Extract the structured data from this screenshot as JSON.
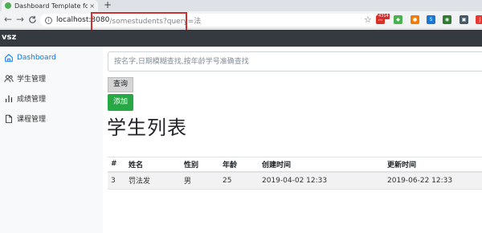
{
  "browser": {
    "tab_title": "Dashboard Template for Boots",
    "tab_close": "×",
    "new_tab": "+",
    "url_host": "localhost:8080",
    "url_path": "/somestudents?query=法",
    "back": "←",
    "forward": "→",
    "reload": "C",
    "extensions": [
      {
        "name": "gmail-extension-icon",
        "color": "#d93025",
        "glyph": "M"
      },
      {
        "name": "shield-extension-icon",
        "color": "#4caf50",
        "glyph": "◆"
      },
      {
        "name": "orange-extension-icon",
        "color": "#f57c00",
        "glyph": "●"
      },
      {
        "name": "blue-extension-icon",
        "color": "#1976d2",
        "glyph": "S"
      },
      {
        "name": "green-extension-icon",
        "color": "#2e7d32",
        "glyph": "◉"
      },
      {
        "name": "camera-extension-icon",
        "color": "#455a64",
        "glyph": "▣"
      },
      {
        "name": "red-extension-icon",
        "color": "#e53935",
        "glyph": "J"
      },
      {
        "name": "check-extension-icon",
        "color": "#d32f2f",
        "glyph": "✓"
      },
      {
        "name": "browser-menu-icon",
        "color": "#e57373",
        "glyph": "●"
      }
    ],
    "ext_badge": "4314"
  },
  "app": {
    "brand": "vsz"
  },
  "sidebar": {
    "items": [
      {
        "label": "Dashboard",
        "icon": "home-icon",
        "active": true
      },
      {
        "label": "学生管理",
        "icon": "users-icon"
      },
      {
        "label": "成绩管理",
        "icon": "bar-chart-icon"
      },
      {
        "label": "课程管理",
        "icon": "file-icon"
      }
    ]
  },
  "search": {
    "placeholder": "按名字,日期模糊查找,按年龄学号准确查找",
    "query_label": "查询",
    "add_label": "添加"
  },
  "page": {
    "title": "学生列表"
  },
  "table": {
    "headers": [
      "#",
      "姓名",
      "性别",
      "年龄",
      "创建时间",
      "更新时间"
    ],
    "rows": [
      [
        "3",
        "罚法发",
        "男",
        "25",
        "2019-04-02 12:33",
        "2019-06-22 12:33"
      ]
    ]
  },
  "colors": {
    "accent": "#007bff",
    "add_button": "#28a745",
    "navbar": "#343a40",
    "highlight_box": "#d32f2f"
  }
}
